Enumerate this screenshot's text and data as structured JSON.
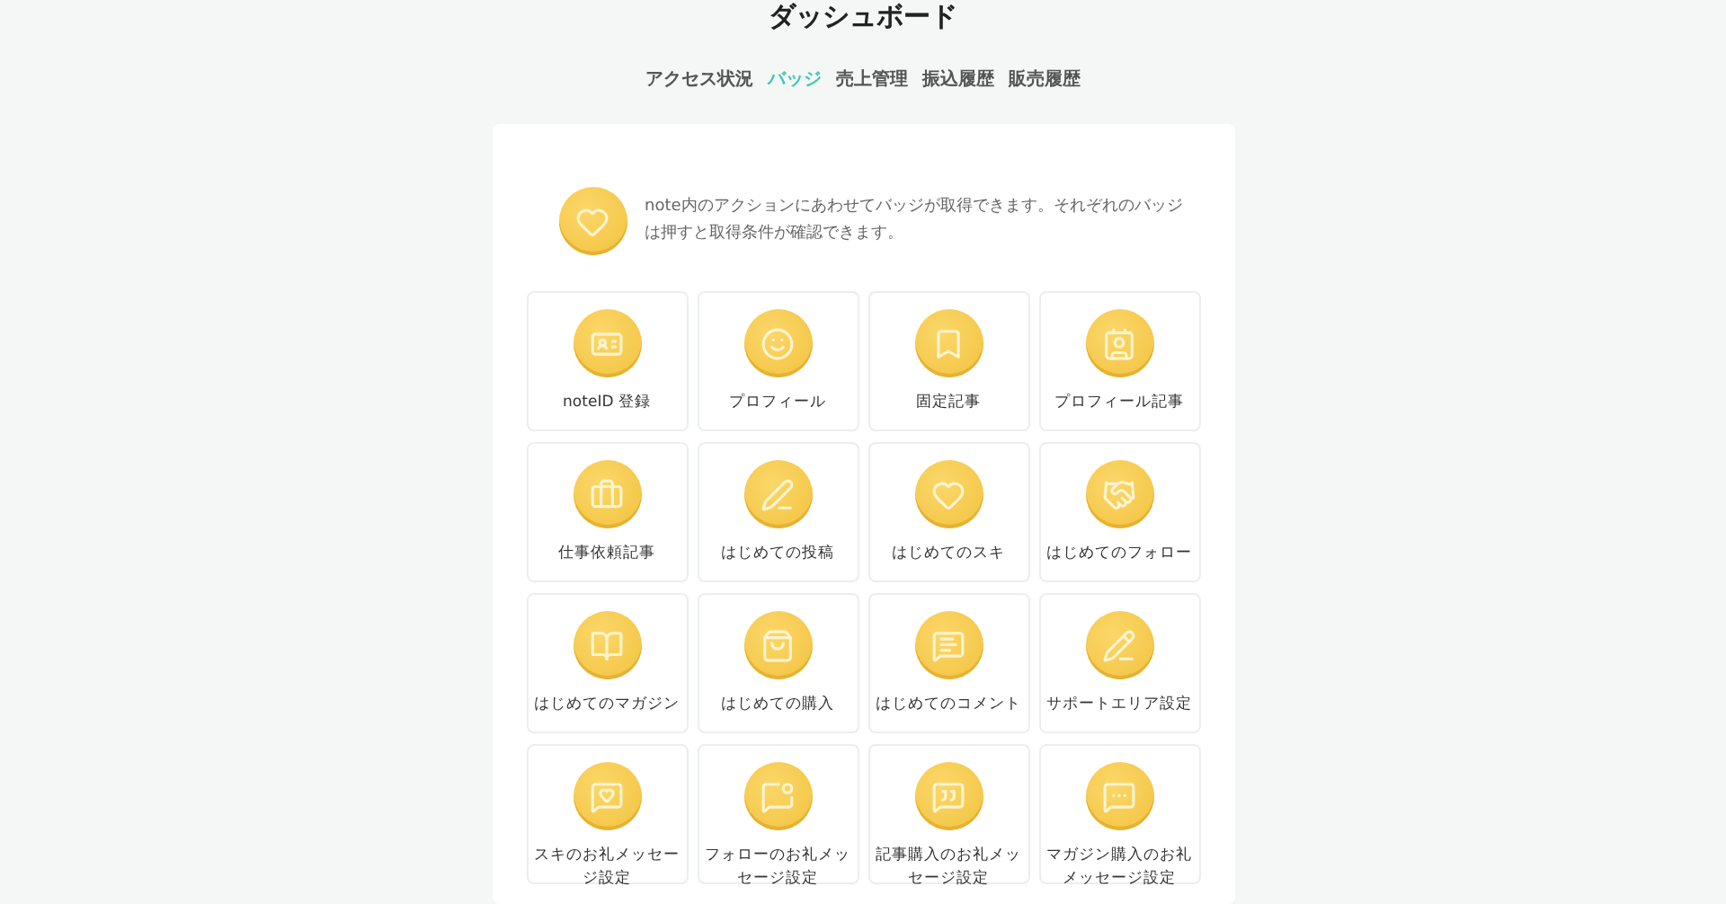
{
  "title": "ダッシュボード",
  "tabs": [
    {
      "label": "アクセス状況",
      "selected": false
    },
    {
      "label": "バッジ",
      "selected": true
    },
    {
      "label": "売上管理",
      "selected": false
    },
    {
      "label": "振込履歴",
      "selected": false
    },
    {
      "label": "販売履歴",
      "selected": false
    }
  ],
  "intro": {
    "text": "note内のアクションにあわせてバッジが取得できます。それぞれのバッジは押すと取得条件が確認できます。"
  },
  "badges": [
    {
      "label": "noteID 登録"
    },
    {
      "label": "プロフィール"
    },
    {
      "label": "固定記事"
    },
    {
      "label": "プロフィール記事"
    },
    {
      "label": "仕事依頼記事"
    },
    {
      "label": "はじめての投稿"
    },
    {
      "label": "はじめてのスキ"
    },
    {
      "label": "はじめてのフォロー"
    },
    {
      "label": "はじめてのマガジン"
    },
    {
      "label": "はじめての購入"
    },
    {
      "label": "はじめてのコメント"
    },
    {
      "label": "サポートエリア設定"
    },
    {
      "label": "スキのお礼メッセージ設定"
    },
    {
      "label": "フォローのお礼メッセージ設定"
    },
    {
      "label": "記事購入のお礼メッセージ設定"
    },
    {
      "label": "マガジン購入のお礼メッセージ設定"
    }
  ]
}
